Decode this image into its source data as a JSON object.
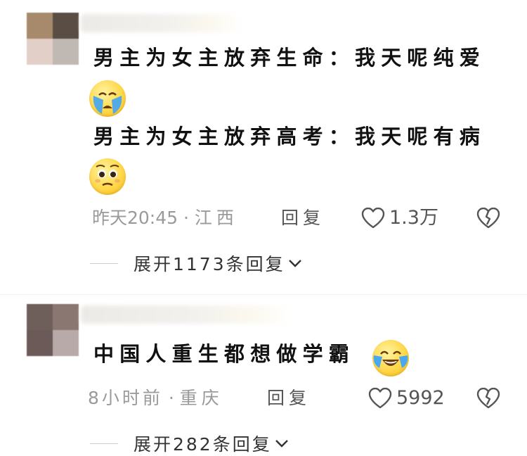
{
  "comments": [
    {
      "text_lines": [
        "男主为女主放弃生命：我天呢纯爱",
        "男主为女主放弃高考：我天呢有病"
      ],
      "emojis": [
        "crying-face-emoji",
        "pleading-face-emoji"
      ],
      "time": "昨天20:45",
      "location": "江西",
      "reply_label": "回复",
      "likes": "1.3万",
      "expand_label": "展开1173条回复"
    },
    {
      "text_lines": [
        "中国人重生都想做学霸"
      ],
      "emojis": [
        "tears-of-joy-emoji"
      ],
      "time": "8小时前",
      "location": "重庆",
      "reply_label": "回复",
      "likes": "5992",
      "expand_label": "展开282条回复"
    }
  ],
  "colors": {
    "text": "#111111",
    "meta": "#9a9a9a",
    "action": "#555555",
    "emoji": "#ffd84a"
  }
}
